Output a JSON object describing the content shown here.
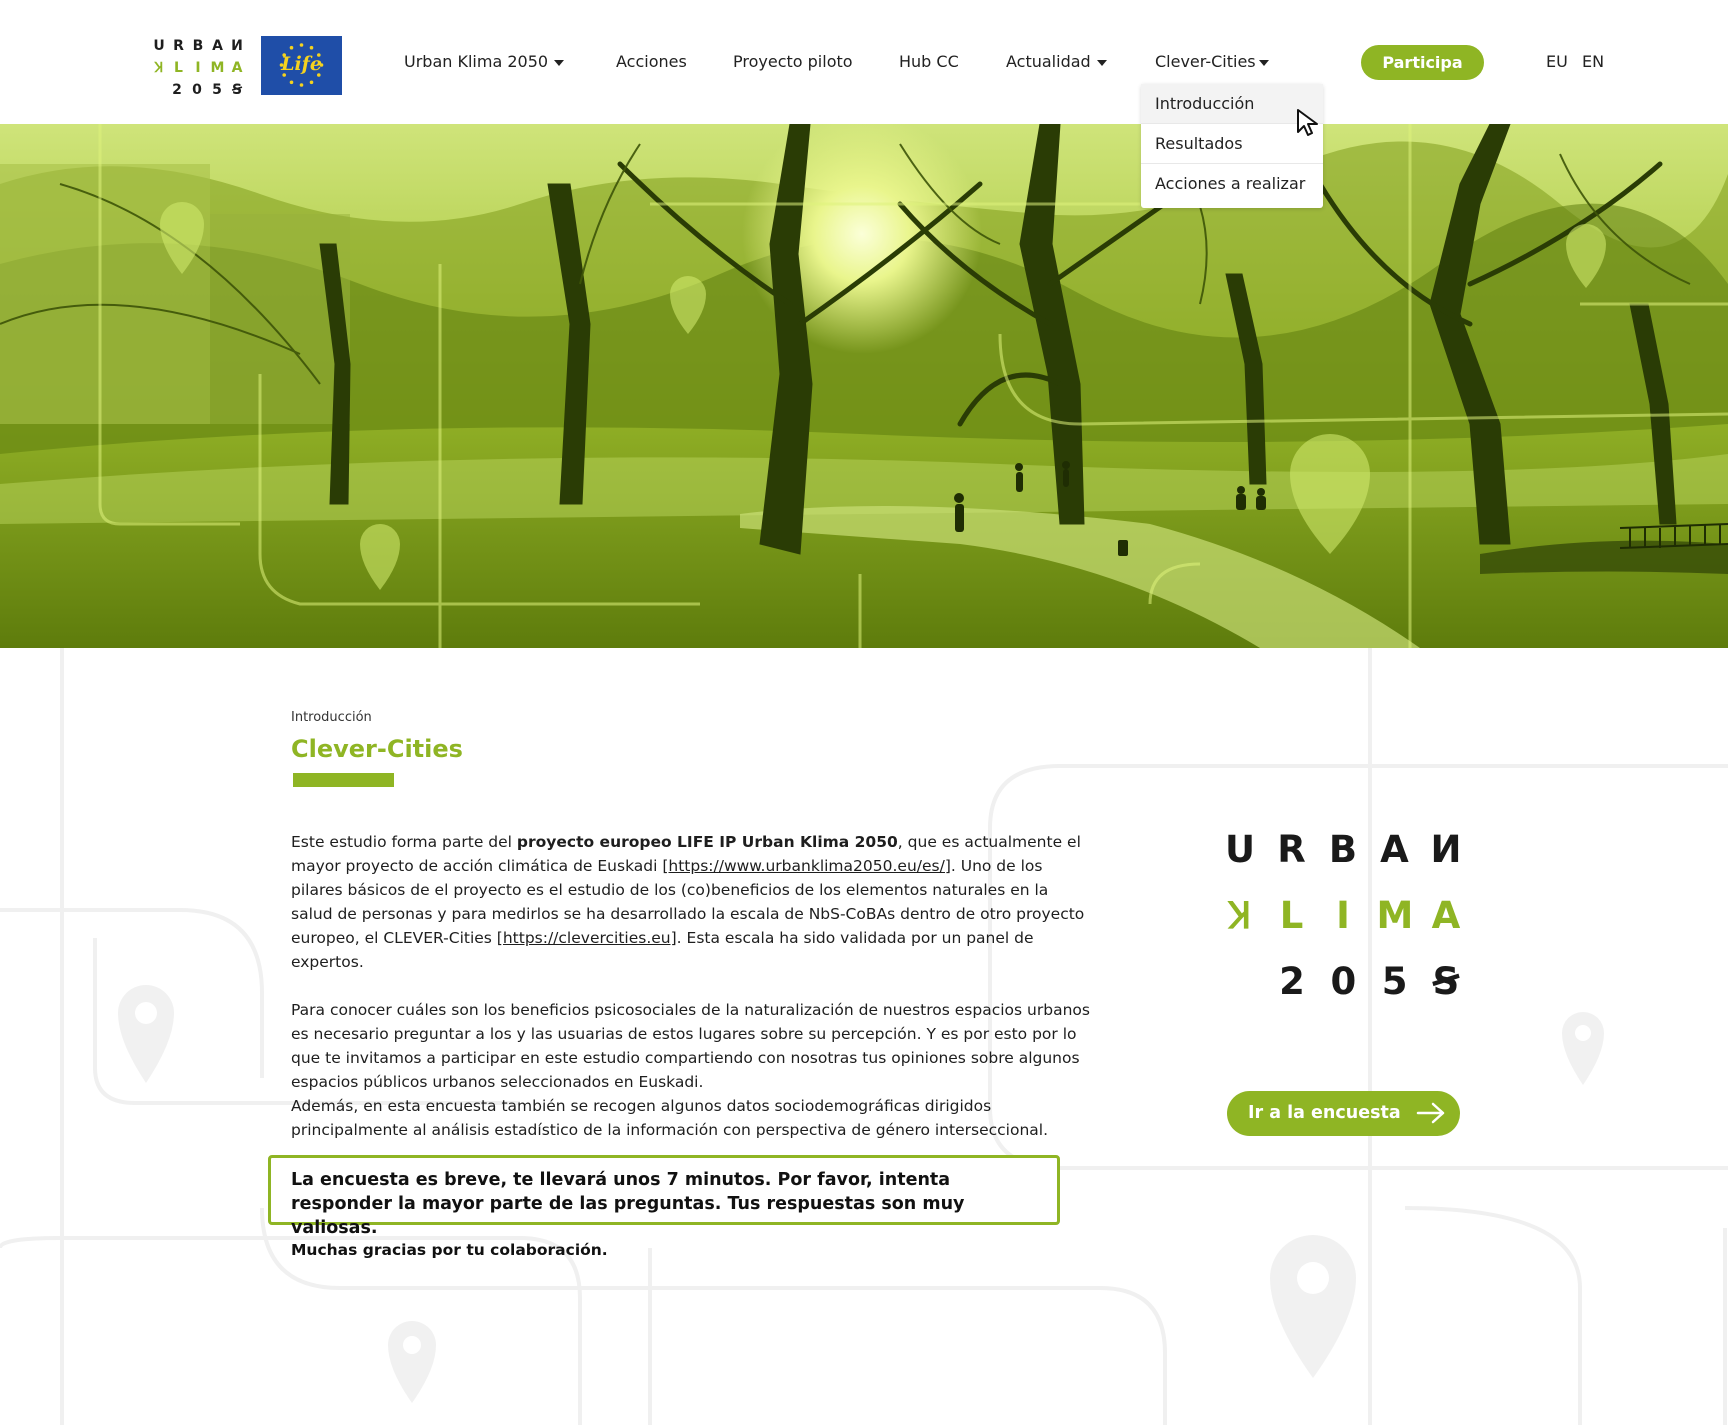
{
  "brand": {
    "logo_rows": [
      [
        "U",
        "R",
        "B",
        "A",
        "И"
      ],
      [
        "Ʞ",
        "L",
        "I",
        "M",
        "A"
      ],
      [
        "2",
        "0",
        "5",
        "Ꞩ"
      ]
    ],
    "life_label": "Life",
    "accent_color": "#8fb524",
    "eu_blue": "#1f4ea8"
  },
  "nav": {
    "items": [
      {
        "label": "Urban Klima 2050",
        "has_dropdown": true
      },
      {
        "label": "Acciones",
        "has_dropdown": false
      },
      {
        "label": "Proyecto piloto",
        "has_dropdown": false
      },
      {
        "label": "Hub CC",
        "has_dropdown": false
      },
      {
        "label": "Actualidad",
        "has_dropdown": true
      },
      {
        "label": "Clever-Cities",
        "has_dropdown": true
      }
    ],
    "cta_label": "Participa",
    "languages": [
      "EU",
      "EN"
    ]
  },
  "dropdown": {
    "items": [
      "Introducción",
      "Resultados",
      "Acciones a realizar"
    ],
    "hovered": "Introducción"
  },
  "page": {
    "breadcrumb": "Introducción",
    "title": "Clever-Cities",
    "p1_a": "Este estudio forma parte del ",
    "p1_bold": "proyecto europeo LIFE IP Urban Klima 2050",
    "p1_b": ", que es actualmente el mayor proyecto de acción climática de Euskadi ",
    "p1_link1": "[https://www.urbanklima2050.eu/es/]",
    "p1_c": ". Uno de los pilares básicos de el proyecto es el estudio de los (co)beneficios de los elementos naturales en la salud de personas y para medirlos se ha desarrollado la escala de NbS-CoBAs dentro de otro proyecto europeo, el CLEVER-Cities ",
    "p1_link2": "[https://clevercities.eu]",
    "p1_d": ". Esta escala ha sido validada por un panel de expertos.",
    "p2": "Para conocer cuáles son los beneficios psicosociales de la naturalización de nuestros espacios urbanos es necesario preguntar a los y las usuarias de estos lugares sobre su percepción. Y es por esto por lo que te invitamos a participar en este estudio compartiendo con nosotras tus opiniones sobre algunos espacios públicos urbanos seleccionados en Euskadi.",
    "p3": "Además, en esta encuesta también se recogen algunos datos sociodemográficas dirigidos principalmente al análisis estadístico de la información con perspectiva de género interseccional.",
    "notice": "La encuesta es breve, te llevará unos 7 minutos. Por favor, intenta responder la mayor parte de las preguntas. Tus respuestas son muy valiosas.",
    "thanks": "Muchas gracias por tu colaboración.",
    "survey_button": "Ir a la encuesta"
  }
}
